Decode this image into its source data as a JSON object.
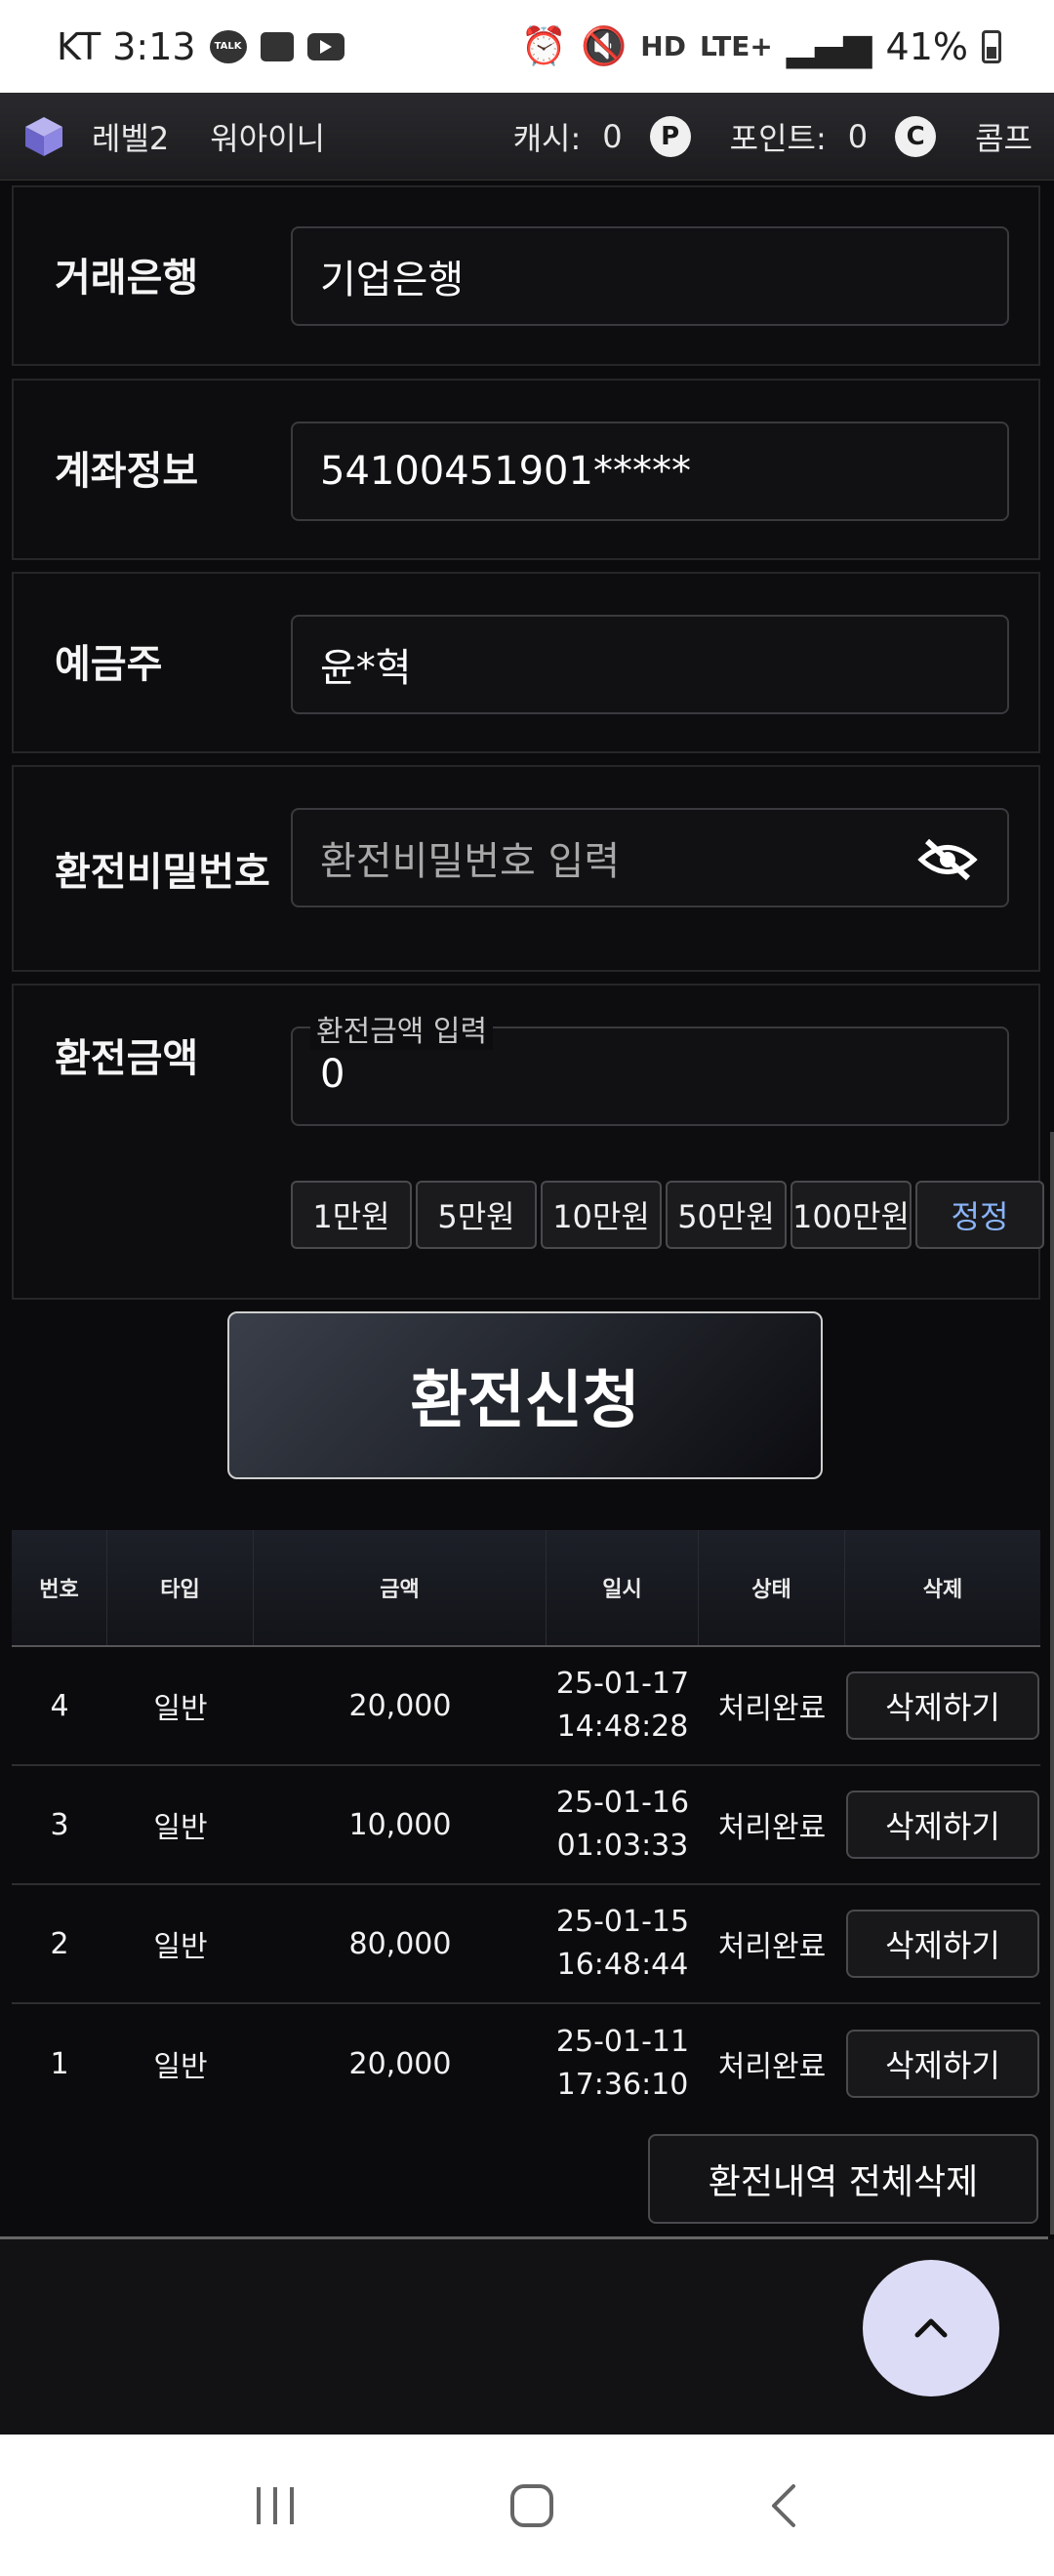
{
  "status_bar": {
    "carrier_time": "KT 3:13",
    "talk": "TALK",
    "hd": "HD",
    "lte": "LTE+",
    "battery": "41%"
  },
  "top_bar": {
    "level": "레벨2",
    "username": "워아이니",
    "cash_label": "캐시:",
    "cash_value": "0",
    "cash_icon": "P",
    "points_label": "포인트:",
    "points_value": "0",
    "comp_icon": "C",
    "comp_label": "콤프"
  },
  "form": {
    "bank": {
      "label": "거래은행",
      "value": "기업은행"
    },
    "account": {
      "label": "계좌정보",
      "value": "54100451901*****"
    },
    "holder": {
      "label": "예금주",
      "value": "윤*혁"
    },
    "password": {
      "label": "환전비밀번호",
      "placeholder": "환전비밀번호 입력"
    },
    "amount": {
      "label": "환전금액",
      "field_label": "환전금액 입력",
      "value": "0",
      "chips": [
        "1만원",
        "5만원",
        "10만원",
        "50만원",
        "100만원",
        "정정"
      ]
    }
  },
  "submit_label": "환전신청",
  "table": {
    "headers": [
      "번호",
      "타입",
      "금액",
      "일시",
      "상태",
      "삭제"
    ],
    "rows": [
      {
        "no": "4",
        "type": "일반",
        "amount": "20,000",
        "date": "25-01-17\n14:48:28",
        "status": "처리완료",
        "action": "삭제하기"
      },
      {
        "no": "3",
        "type": "일반",
        "amount": "10,000",
        "date": "25-01-16\n01:03:33",
        "status": "처리완료",
        "action": "삭제하기"
      },
      {
        "no": "2",
        "type": "일반",
        "amount": "80,000",
        "date": "25-01-15\n16:48:44",
        "status": "처리완료",
        "action": "삭제하기"
      },
      {
        "no": "1",
        "type": "일반",
        "amount": "20,000",
        "date": "25-01-11\n17:36:10",
        "status": "처리완료",
        "action": "삭제하기"
      }
    ]
  },
  "delete_all_label": "환전내역 전체삭제"
}
